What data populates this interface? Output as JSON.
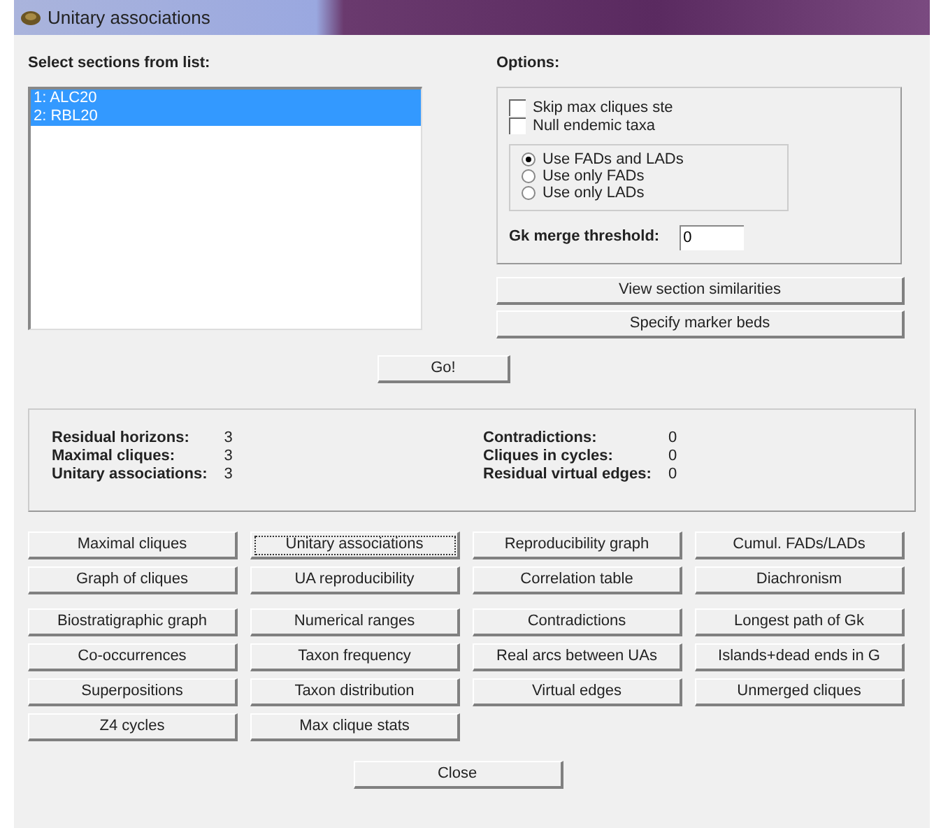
{
  "window": {
    "title": "Unitary associations"
  },
  "sections": {
    "label": "Select sections from list:",
    "items": [
      {
        "label": "1: ALC20",
        "selected": true
      },
      {
        "label": "2: RBL20",
        "selected": true
      }
    ]
  },
  "options": {
    "label": "Options:",
    "checkboxes": [
      {
        "label": "Skip max cliques ste",
        "checked": false
      },
      {
        "label": "Null endemic taxa",
        "checked": false
      }
    ],
    "radios": [
      {
        "label": "Use FADs and LADs",
        "selected": true
      },
      {
        "label": "Use only FADs",
        "selected": false
      },
      {
        "label": "Use only LADs",
        "selected": false
      }
    ],
    "threshold": {
      "label": "Gk merge threshold:",
      "value": "0"
    },
    "buttons": [
      "View section similarities",
      "Specify marker beds"
    ]
  },
  "go_button": "Go!",
  "stats": [
    {
      "label": "Residual horizons:",
      "value": "3"
    },
    {
      "label": "Maximal cliques:",
      "value": "3"
    },
    {
      "label": "Unitary associations:",
      "value": "3"
    },
    {
      "label": "Contradictions:",
      "value": "0"
    },
    {
      "label": "Cliques in cycles:",
      "value": "0"
    },
    {
      "label": "Residual virtual edges:",
      "value": "0"
    }
  ],
  "button_groups": [
    [
      {
        "label": "Maximal cliques",
        "focused": false
      },
      {
        "label": "Unitary associations",
        "focused": true
      },
      {
        "label": "Reproducibility graph",
        "focused": false
      },
      {
        "label": "Cumul. FADs/LADs",
        "focused": false
      },
      {
        "label": "Graph of cliques",
        "focused": false
      },
      {
        "label": "UA reproducibility",
        "focused": false
      },
      {
        "label": "Correlation table",
        "focused": false
      },
      {
        "label": "Diachronism",
        "focused": false
      }
    ],
    [
      {
        "label": "Biostratigraphic graph",
        "focused": false
      },
      {
        "label": "Numerical ranges",
        "focused": false
      },
      {
        "label": "Contradictions",
        "focused": false
      },
      {
        "label": "Longest path of Gk",
        "focused": false
      },
      {
        "label": "Co-occurrences",
        "focused": false
      },
      {
        "label": "Taxon frequency",
        "focused": false
      },
      {
        "label": "Real arcs between UAs",
        "focused": false
      },
      {
        "label": "Islands+dead ends in G",
        "focused": false
      },
      {
        "label": "Superpositions",
        "focused": false
      },
      {
        "label": "Taxon distribution",
        "focused": false
      },
      {
        "label": "Virtual edges",
        "focused": false
      },
      {
        "label": "Unmerged cliques",
        "focused": false
      },
      {
        "label": "Z4 cycles",
        "focused": false
      },
      {
        "label": "Max clique stats",
        "focused": false
      }
    ]
  ],
  "close_button": "Close"
}
